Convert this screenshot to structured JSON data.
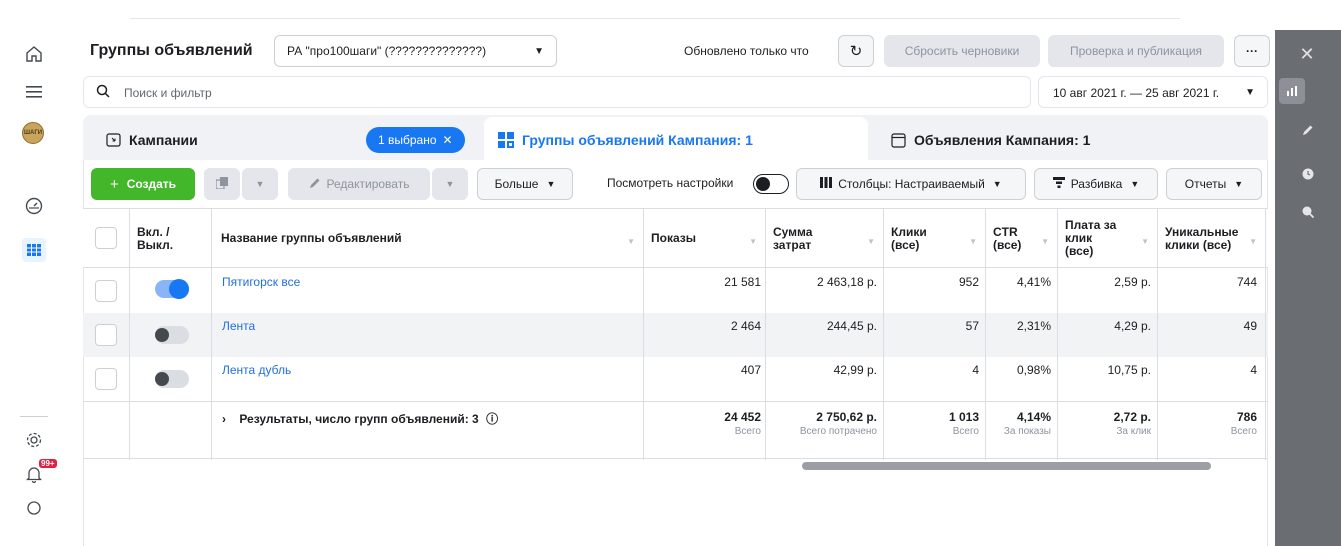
{
  "header": {
    "title": "Группы объявлений",
    "account": "РА \"про100шаги\" (??????????????)",
    "updated": "Обновлено только что",
    "discard": "Сбросить черновики",
    "review": "Проверка и публикация",
    "more": "···"
  },
  "search": {
    "placeholder": "Поиск и фильтр"
  },
  "date_range": "10 авг 2021 г. — 25 авг 2021 г.",
  "tabs": [
    {
      "label": "Кампании"
    },
    {
      "label": "Группы объявлений Кампания: 1"
    },
    {
      "label": "Объявления Кампания: 1"
    }
  ],
  "selected_pill": "1 выбрано",
  "toolbar": {
    "create": "Создать",
    "edit": "Редактировать",
    "more": "Больше",
    "view_settings": "Посмотреть настройки",
    "columns": "Столбцы: Настраиваемый",
    "breakdown": "Разбивка",
    "reports": "Отчеты"
  },
  "columns": {
    "onoff": "Вкл. / Выкл.",
    "name": "Название группы объявлений",
    "impressions": "Показы",
    "spend": "Сумма затрат",
    "clicks": "Клики (все)",
    "ctr": "CTR (все)",
    "cpc": "Плата за клик (все)",
    "unique": "Уникальные клики (все)"
  },
  "rows": [
    {
      "name": "Пятигорск все",
      "on": true,
      "impressions": "21 581",
      "spend": "2 463,18 р.",
      "clicks": "952",
      "ctr": "4,41%",
      "cpc": "2,59 р.",
      "unique": "744"
    },
    {
      "name": "Лента",
      "on": false,
      "impressions": "2 464",
      "spend": "244,45 р.",
      "clicks": "57",
      "ctr": "2,31%",
      "cpc": "4,29 р.",
      "unique": "49"
    },
    {
      "name": "Лента дубль",
      "on": false,
      "impressions": "407",
      "spend": "42,99 р.",
      "clicks": "4",
      "ctr": "0,98%",
      "cpc": "10,75 р.",
      "unique": "4"
    }
  ],
  "totals": {
    "label": "Результаты, число групп объявлений: 3",
    "impressions": "24 452",
    "impressions_sub": "Всего",
    "spend": "2 750,62 р.",
    "spend_sub": "Всего потрачено",
    "clicks": "1 013",
    "clicks_sub": "Всего",
    "ctr": "4,14%",
    "ctr_sub": "За показы",
    "cpc": "2,72 р.",
    "cpc_sub": "За клик",
    "unique": "786",
    "unique_sub": "Всего"
  },
  "notifications_badge": "99+",
  "avatar_text": "ШАГИ",
  "colors": {
    "accent": "#1877f2",
    "create": "#42b72a",
    "link": "#216fdb",
    "sidebar_dark": "#6a6d72"
  }
}
